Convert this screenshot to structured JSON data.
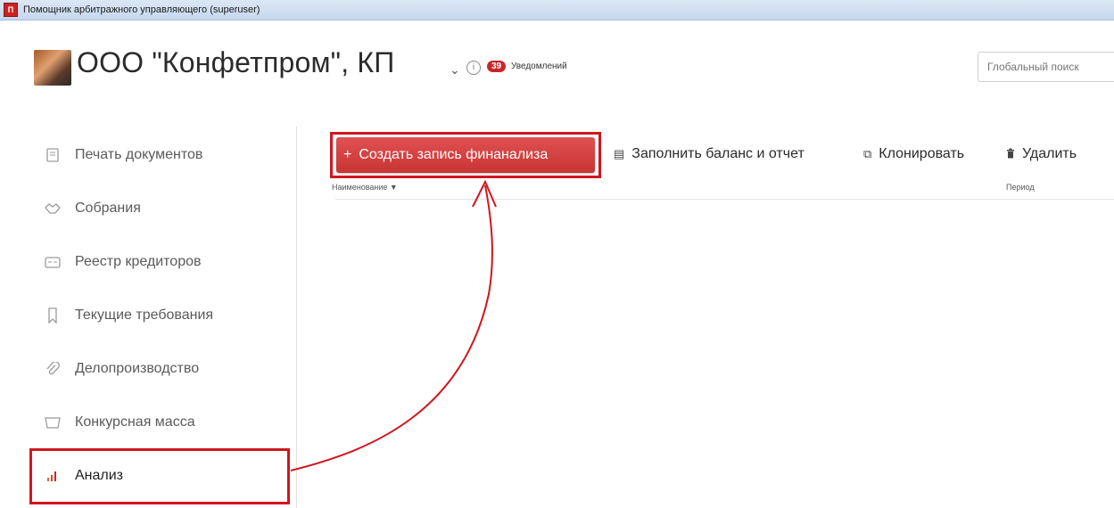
{
  "window": {
    "title": "Помощник арбитражного управляющего (superuser)",
    "app_icon": "app-logo-icon"
  },
  "header": {
    "company_name": "ООО \"Конфетпром\", КП",
    "notifications_count": "39",
    "notifications_label": "Уведомлений",
    "search_placeholder": "Глобальный поиск"
  },
  "sidebar": {
    "items": [
      {
        "label": "Печать документов",
        "icon": "document-icon"
      },
      {
        "label": "Собрания",
        "icon": "handshake-icon"
      },
      {
        "label": "Реестр кредиторов",
        "icon": "id-card-icon"
      },
      {
        "label": "Текущие требования",
        "icon": "bookmark-icon"
      },
      {
        "label": "Делопроизводство",
        "icon": "paperclip-icon"
      },
      {
        "label": "Конкурсная масса",
        "icon": "box-icon"
      },
      {
        "label": "Анализ",
        "icon": "bar-chart-icon",
        "active": true
      }
    ]
  },
  "toolbar": {
    "create_label": "Создать запись финанализа",
    "fill_label": "Заполнить баланс и отчет",
    "clone_label": "Клонировать",
    "delete_label": "Удалить"
  },
  "table": {
    "columns": [
      "Наименование ▼",
      "Период"
    ]
  },
  "colors": {
    "accent_red": "#d0161e",
    "button_red": "#d43f3f"
  }
}
